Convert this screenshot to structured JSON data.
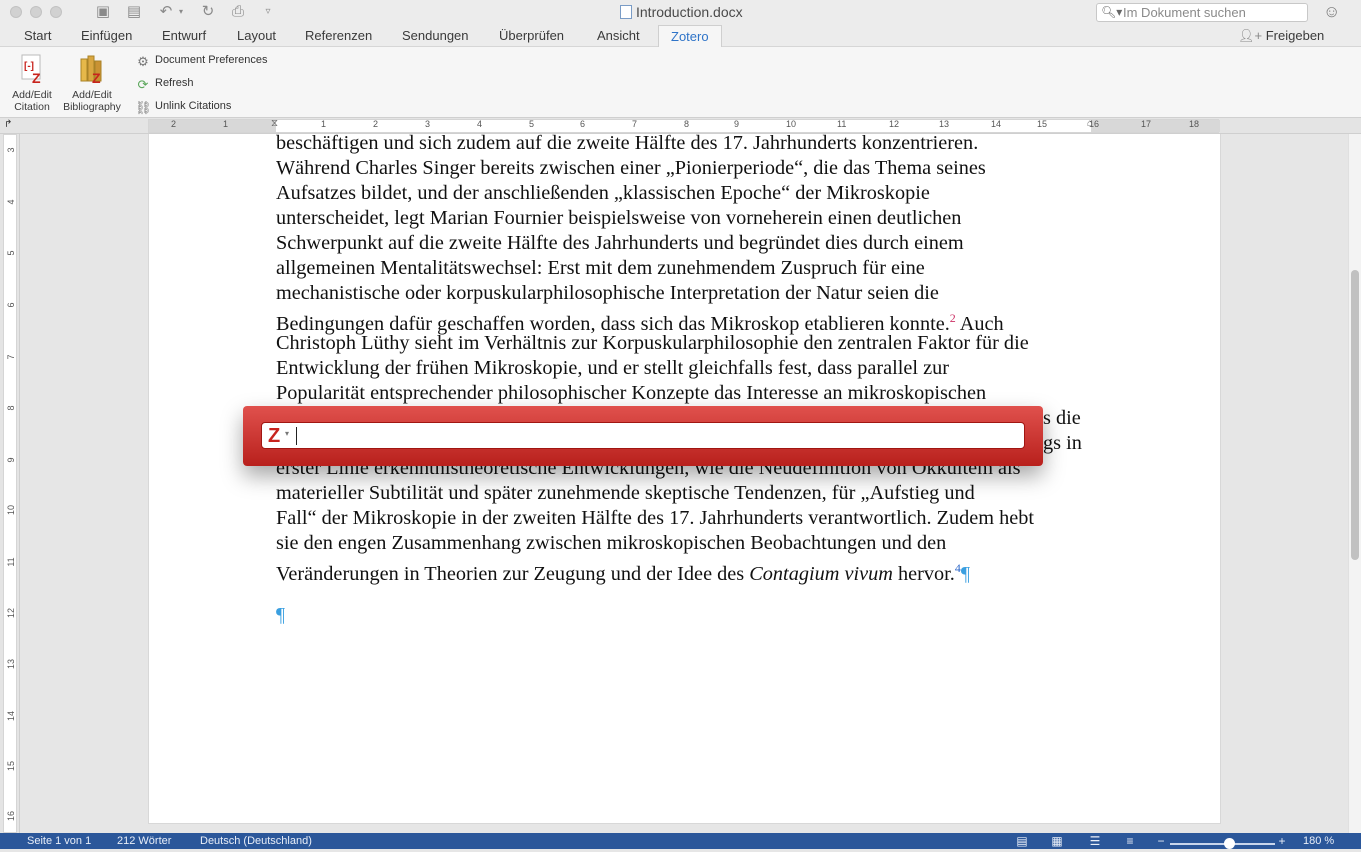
{
  "window": {
    "title": "Introduction.docx",
    "search_placeholder": "Im Dokument suchen",
    "share_label": "Freigeben"
  },
  "tabs": [
    {
      "label": "Start"
    },
    {
      "label": "Einfügen"
    },
    {
      "label": "Entwurf"
    },
    {
      "label": "Layout"
    },
    {
      "label": "Referenzen"
    },
    {
      "label": "Sendungen"
    },
    {
      "label": "Überprüfen"
    },
    {
      "label": "Ansicht"
    },
    {
      "label": "Zotero",
      "active": true
    }
  ],
  "ribbon": {
    "add_edit_citation": "Add/Edit Citation",
    "add_edit_citation_l1": "Add/Edit",
    "add_edit_citation_l2": "Citation",
    "add_edit_bibliography_l1": "Add/Edit",
    "add_edit_bibliography_l2": "Bibliography",
    "document_preferences": "Document Preferences",
    "refresh": "Refresh",
    "unlink_citations": "Unlink Citations"
  },
  "ruler": {
    "numbers": [
      "2",
      "1",
      "1",
      "2",
      "3",
      "4",
      "5",
      "6",
      "7",
      "8",
      "9",
      "10",
      "11",
      "12",
      "13",
      "14",
      "15",
      "16",
      "17",
      "18"
    ],
    "vertical_numbers": [
      "3",
      "4",
      "5",
      "6",
      "7",
      "8",
      "9",
      "10",
      "11",
      "12",
      "13",
      "14",
      "15",
      "16"
    ]
  },
  "document": {
    "lines": [
      "beschäftigen und sich zudem auf die zweite Hälfte des 17. Jahrhunderts konzentrieren.",
      "Während Charles Singer bereits zwischen einer „Pionierperiode“, die das Thema seines",
      "Aufsatzes bildet, und der anschließenden „klassischen Epoche“ der Mikroskopie",
      "unterscheidet, legt Marian Fournier beispielsweise von vorneherein einen deutlichen",
      "Schwerpunkt auf die zweite Hälfte des Jahrhunderts und begründet dies durch einem",
      "allgemeinen Mentalitätswechsel: Erst mit dem zunehmendem Zuspruch für eine",
      "mechanistische oder korpuskularphilosophische Interpretation der Natur seien die"
    ],
    "line8_a": "Bedingungen dafür geschaffen worden, dass sich das Mikroskop etablieren konnte.",
    "footnote_2": "2",
    "line8_b": " Auch",
    "lines_b": [
      "Christoph Lüthy sieht im Verhältnis zur Korpuskularphilosophie den zentralen Faktor für die",
      "Entwicklung der frühen Mikroskopie, und er stellt gleichfalls fest, dass parallel zur",
      "Popularität entsprechender philosophischer Konzepte das Interesse an mikroskopischen"
    ],
    "hidden_line_1_tail": "s die",
    "hidden_line_2_tail": "gs in",
    "line_partial": "erster Linie erkenntnistheoretische Entwicklungen, wie die Neudefinition von Okkultem als",
    "lines_c": [
      "materieller Subtilität und später zunehmende skeptische Tendenzen, für „Aufstieg und",
      "Fall“ der Mikroskopie in der zweiten Hälfte des 17. Jahrhunderts verantwortlich. Zudem hebt",
      "sie den engen Zusammenhang zwischen mikroskopischen Beobachtungen und den"
    ],
    "last_line_a": "Veränderungen in Theorien zur Zeugung und der Idee des ",
    "last_line_italic": "Contagium vivum",
    "last_line_b": " hervor.",
    "footnote_4": "4",
    "pilcrow": "¶"
  },
  "zotero_dialog": {
    "logo": "Z",
    "dropdown": "▾",
    "input_value": ""
  },
  "status": {
    "page": "Seite 1 von 1",
    "words": "212 Wörter",
    "language": "Deutsch (Deutschland)",
    "zoom": "180 %"
  },
  "colors": {
    "accent": "#2f74c8",
    "zotero_red": "#c8231d",
    "status_bar": "#2b579a"
  }
}
